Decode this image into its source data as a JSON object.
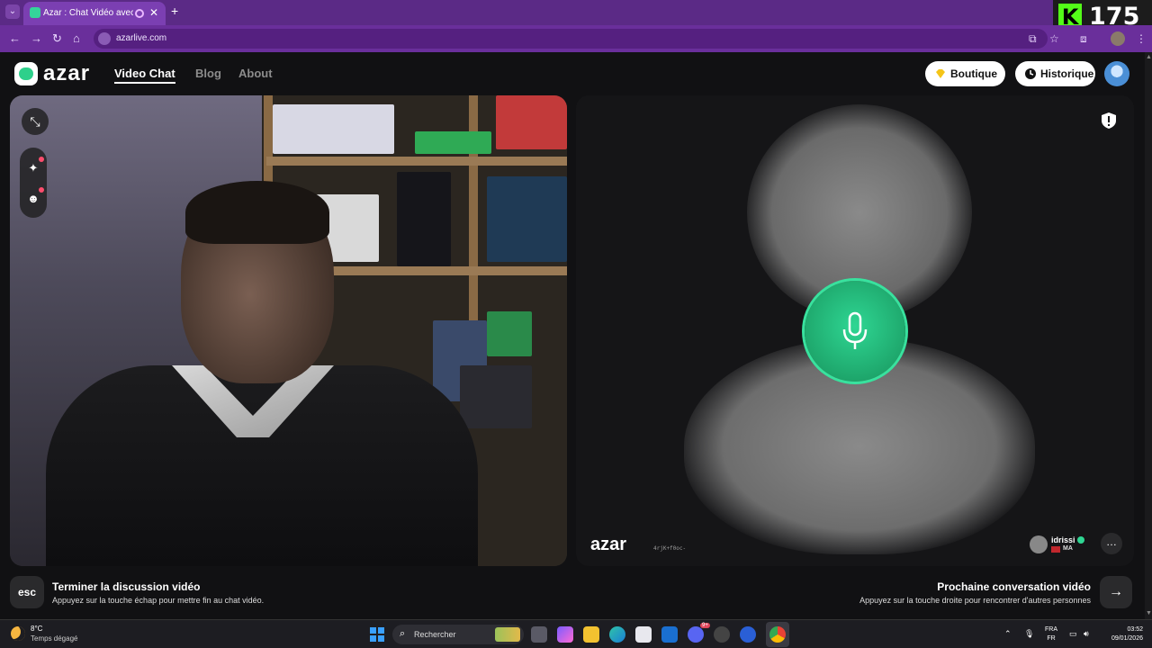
{
  "browser": {
    "tab_title": "Azar : Chat Vidéo avec de n",
    "url": "azarlive.com",
    "counter_value": "175",
    "counter_logo": "K"
  },
  "header": {
    "logo": "azar",
    "nav": [
      "Video Chat",
      "Blog",
      "About"
    ],
    "active_nav": "Video Chat",
    "shop_label": "Boutique",
    "history_label": "Historique"
  },
  "remote": {
    "watermark": "azar",
    "hash": "4rjK+f0oc-",
    "peer_name": "idrissi",
    "peer_country": "MA"
  },
  "bottom": {
    "esc_key": "esc",
    "end_title": "Terminer la discussion vidéo",
    "end_sub": "Appuyez sur la touche échap pour mettre fin au chat vidéo.",
    "next_title": "Prochaine conversation vidéo",
    "next_sub": "Appuyez sur la touche droite pour rencontrer d'autres personnes",
    "next_arrow": "→"
  },
  "taskbar": {
    "weather_temp": "8°C",
    "weather_desc": "Temps dégagé",
    "search_label": "Rechercher",
    "lang_top": "FRA",
    "lang_bottom": "FR",
    "time": "03:52",
    "date": "09/01/2026",
    "notification_badge": "9+"
  },
  "colors": {
    "accent": "#2fd693",
    "browser_chrome": "#6a2f9b",
    "background": "#111113"
  }
}
